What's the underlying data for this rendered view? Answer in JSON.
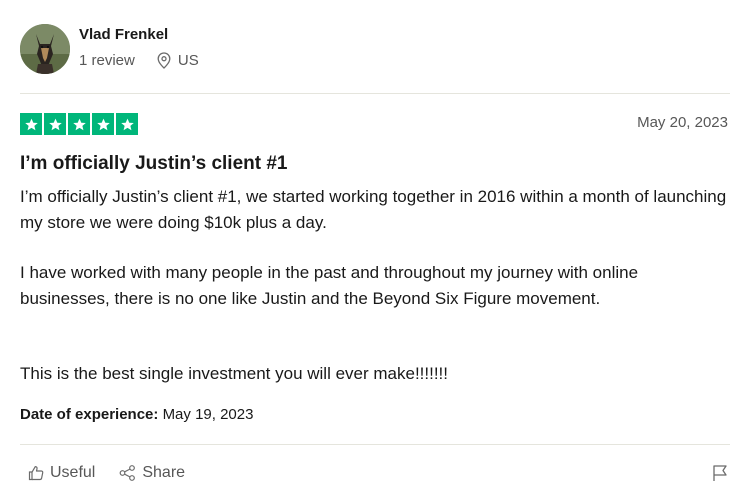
{
  "reviewer": {
    "name": "Vlad Frenkel",
    "reviews": "1 review",
    "location": "US"
  },
  "rating": {
    "stars": 5,
    "max": 5,
    "color": "#00b67a"
  },
  "review": {
    "date": "May 20, 2023",
    "title": "I’m officially Justin’s client #1",
    "paragraphs": [
      "I’m officially Justin’s client #1, we started working together in 2016 within a month of launching my store we were doing $10k plus a day.",
      "I have worked with many people in the past and throughout my journey with online businesses, there is no one like Justin and the Beyond Six Figure movement.",
      "This is the best single investment you will ever make!!!!!!!"
    ],
    "experience_label": "Date of experience:",
    "experience_date": "May 19, 2023"
  },
  "actions": {
    "useful_label": "Useful",
    "share_label": "Share"
  },
  "icons": [
    "avatar-photo",
    "location-pin-icon",
    "star-icon",
    "thumbs-up-icon",
    "share-icon",
    "flag-icon"
  ]
}
